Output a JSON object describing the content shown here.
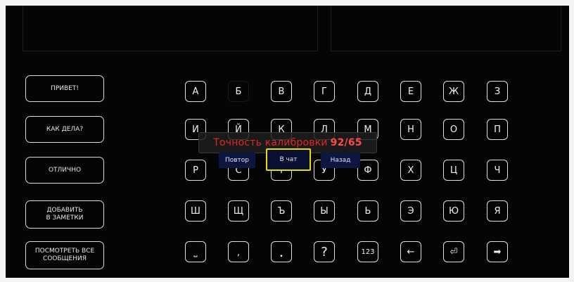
{
  "phrases": [
    {
      "label": "ПРИВЕТ!"
    },
    {
      "label": "КАК ДЕЛА?"
    },
    {
      "label": "ОТЛИЧНО"
    },
    {
      "label": "ДОБАВИТЬ\nВ ЗАМЕТКИ"
    },
    {
      "label": "ПОСМОТРЕТЬ ВСЕ\nСООБЩЕНИЯ"
    }
  ],
  "keys": {
    "row1": [
      "А",
      "Б",
      "В",
      "Г",
      "Д",
      "Е",
      "Ж",
      "З"
    ],
    "row2": [
      "И",
      "Й",
      "К",
      "Л",
      "М",
      "Н",
      "О",
      "П"
    ],
    "row3": [
      "Р",
      "С",
      "Т",
      "У",
      "Ф",
      "Х",
      "Ц",
      "Ч"
    ],
    "row4": [
      "Ш",
      "Щ",
      "Ъ",
      "Ы",
      "Ь",
      "Э",
      "Ю",
      "Я"
    ],
    "row5": [
      "⎵",
      ",",
      ".",
      "?",
      "123",
      "←",
      "⏎",
      "➡"
    ]
  },
  "calibration": {
    "title": "Точность калибровки",
    "score": "92/65",
    "retry_label": "Повтор",
    "chat_label": "В чат",
    "back_label": "Назад"
  },
  "colors": {
    "background": "#050505",
    "calibration_text": "#e02828",
    "highlight": "#e6e000",
    "button_bg": "#0c1640"
  }
}
